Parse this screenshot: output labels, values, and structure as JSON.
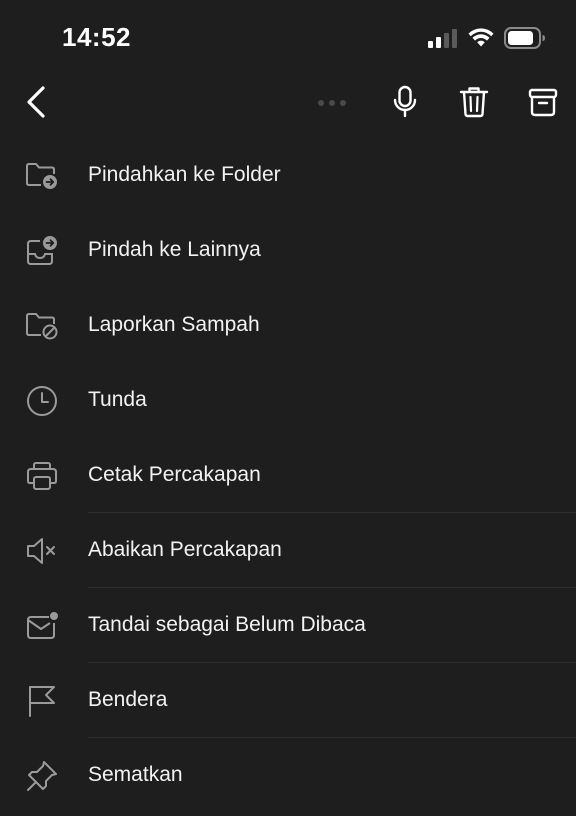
{
  "status_bar": {
    "time": "14:52"
  },
  "toolbar": {
    "back_icon": "chevron-left-icon",
    "mic_icon": "microphone-icon",
    "delete_icon": "trash-icon",
    "archive_icon": "archive-icon"
  },
  "menu": {
    "items": [
      {
        "label": "Pindahkan ke Folder",
        "icon": "folder-move-icon"
      },
      {
        "label": "Pindah ke Lainnya",
        "icon": "inbox-move-icon"
      },
      {
        "label": "Laporkan Sampah",
        "icon": "folder-block-icon"
      },
      {
        "label": "Tunda",
        "icon": "clock-icon"
      },
      {
        "label": "Cetak Percakapan",
        "icon": "printer-icon"
      },
      {
        "label": "Abaikan Percakapan",
        "icon": "speaker-mute-icon"
      },
      {
        "label": "Tandai sebagai Belum Dibaca",
        "icon": "mail-unread-icon"
      },
      {
        "label": "Bendera",
        "icon": "flag-icon"
      },
      {
        "label": "Sematkan",
        "icon": "pin-icon"
      }
    ]
  },
  "colors": {
    "background": "#1e1e1e",
    "text": "#f2f2f2",
    "icon": "#9a9a9a",
    "divider": "#2f2f2f"
  }
}
